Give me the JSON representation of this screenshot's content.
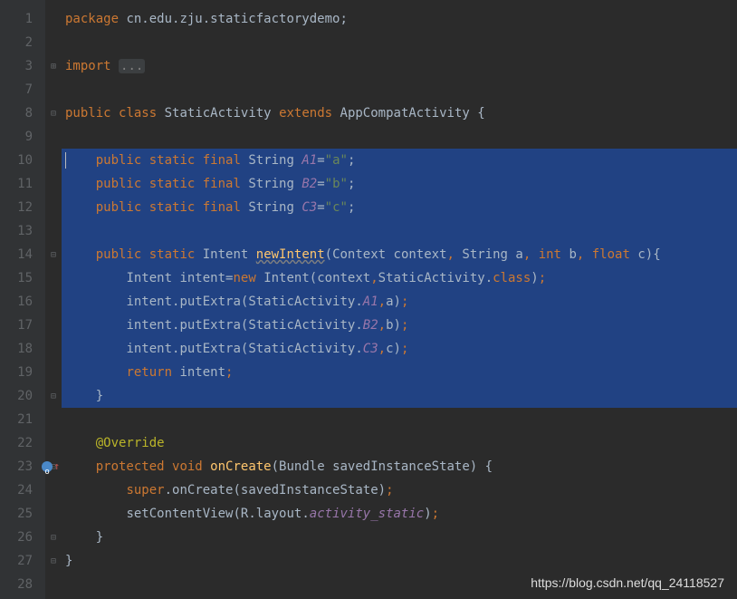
{
  "gutter": {
    "lines": [
      "1",
      "2",
      "3",
      "7",
      "8",
      "9",
      "10",
      "11",
      "12",
      "13",
      "14",
      "15",
      "16",
      "17",
      "18",
      "19",
      "20",
      "21",
      "22",
      "23",
      "24",
      "25",
      "26",
      "27",
      "28"
    ]
  },
  "fold": {
    "l3": "⊞",
    "l8": "⊟",
    "l14": "⊟",
    "l20": "⊟",
    "l23": "⊟",
    "l26": "⊟",
    "l27": "⊟"
  },
  "code": {
    "l1": {
      "kw1": "package",
      "pkg": " cn.edu.zju.staticfactorydemo",
      "semi": ";"
    },
    "l3": {
      "kw1": "import",
      "dots": "..."
    },
    "l8": {
      "kw1": "public",
      "kw2": "class",
      "name": "StaticActivity",
      "kw3": "extends",
      "parent": "AppCompatActivity",
      "brace": "{"
    },
    "l10": {
      "kw1": "public",
      "kw2": "static",
      "kw3": "final",
      "type": "String",
      "field": "A1",
      "eq": "=",
      "str": "\"a\"",
      "semi": ";"
    },
    "l11": {
      "kw1": "public",
      "kw2": "static",
      "kw3": "final",
      "type": "String",
      "field": "B2",
      "eq": "=",
      "str": "\"b\"",
      "semi": ";"
    },
    "l12": {
      "kw1": "public",
      "kw2": "static",
      "kw3": "final",
      "type": "String",
      "field": "C3",
      "eq": "=",
      "str": "\"c\"",
      "semi": ";"
    },
    "l14": {
      "kw1": "public",
      "kw2": "static",
      "ret": "Intent",
      "name": "newIntent",
      "p1t": "Context",
      "p1n": "context",
      "p2t": "String",
      "p2n": "a",
      "p3t": "int",
      "p3n": "b",
      "p4t": "float",
      "p4n": "c"
    },
    "l15": {
      "type": "Intent",
      "var": "intent",
      "eq": "=",
      "kw1": "new",
      "ctor": "Intent",
      "arg1": "context",
      "arg2": "StaticActivity",
      "kw2": "class"
    },
    "l16": {
      "var": "intent",
      "method": "putExtra",
      "cls": "StaticActivity",
      "field": "A1",
      "arg": "a"
    },
    "l17": {
      "var": "intent",
      "method": "putExtra",
      "cls": "StaticActivity",
      "field": "B2",
      "arg": "b"
    },
    "l18": {
      "var": "intent",
      "method": "putExtra",
      "cls": "StaticActivity",
      "field": "C3",
      "arg": "c"
    },
    "l19": {
      "kw1": "return",
      "var": "intent"
    },
    "l20": {
      "brace": "}"
    },
    "l22": {
      "ann": "@Override"
    },
    "l23": {
      "kw1": "protected",
      "kw2": "void",
      "name": "onCreate",
      "ptype": "Bundle",
      "pname": "savedInstanceState"
    },
    "l24": {
      "kw1": "super",
      "method": "onCreate",
      "arg": "savedInstanceState"
    },
    "l25": {
      "method": "setContentView",
      "r": "R",
      "layout": "layout",
      "field": "activity_static"
    },
    "l26": {
      "brace": "}"
    },
    "l27": {
      "brace": "}"
    }
  },
  "watermark": "https://blog.csdn.net/qq_24118527"
}
